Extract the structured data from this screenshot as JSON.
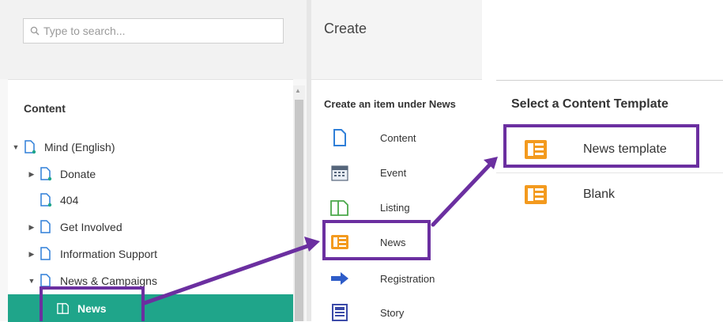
{
  "search": {
    "placeholder": "Type to search..."
  },
  "tree": {
    "heading": "Content",
    "items": [
      {
        "label": "Mind (English)"
      },
      {
        "label": "Donate"
      },
      {
        "label": "404"
      },
      {
        "label": "Get Involved"
      },
      {
        "label": "Information Support"
      },
      {
        "label": "News & Campaigns"
      },
      {
        "label": "News"
      }
    ]
  },
  "create": {
    "title": "Create",
    "subtitle": "Create an item under News",
    "items": [
      {
        "label": "Content",
        "icon": "document-icon"
      },
      {
        "label": "Event",
        "icon": "calendar-icon"
      },
      {
        "label": "Listing",
        "icon": "listing-icon"
      },
      {
        "label": "News",
        "icon": "newspaper-icon"
      },
      {
        "label": "Registration",
        "icon": "arrow-right-icon"
      },
      {
        "label": "Story",
        "icon": "story-icon"
      }
    ]
  },
  "templates": {
    "title": "Select a Content Template",
    "items": [
      {
        "label": "News template",
        "icon": "newspaper-icon"
      },
      {
        "label": "Blank",
        "icon": "newspaper-icon"
      }
    ]
  },
  "colors": {
    "selected": "#1fa58a",
    "annotation": "#6b2fa0",
    "news_icon": "#f39a1e",
    "doc_icon": "#2f7fd8"
  }
}
